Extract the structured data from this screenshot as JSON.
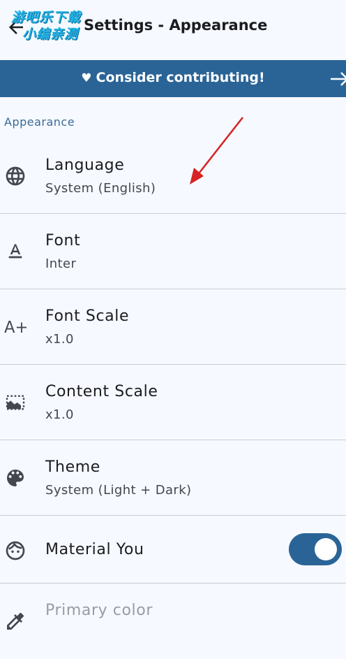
{
  "header": {
    "title": "Settings - Appearance",
    "back_icon": "arrow-left-icon"
  },
  "watermark": {
    "line1": "游吧乐下载",
    "line2": "小编亲测"
  },
  "banner": {
    "heart": "♥",
    "text": "Consider contributing!",
    "arrow_icon": "arrow-right-icon"
  },
  "section": {
    "label": "Appearance"
  },
  "settings": [
    {
      "icon": "globe-icon",
      "title": "Language",
      "subtitle": "System (English)"
    },
    {
      "icon": "font-icon",
      "title": "Font",
      "subtitle": "Inter"
    },
    {
      "icon": "font-scale-icon",
      "title": "Font Scale",
      "subtitle": "x1.0"
    },
    {
      "icon": "content-scale-icon",
      "title": "Content Scale",
      "subtitle": "x1.0"
    },
    {
      "icon": "palette-icon",
      "title": "Theme",
      "subtitle": "System (Light + Dark)"
    },
    {
      "icon": "face-icon",
      "title": "Material You",
      "toggle_on": true
    },
    {
      "icon": "color-picker-icon",
      "title": "Primary color",
      "disabled": true
    }
  ],
  "colors": {
    "accent": "#2a6497",
    "background": "#f6f9ff",
    "section_label": "#3c6b97",
    "annotation": "#d62424"
  }
}
